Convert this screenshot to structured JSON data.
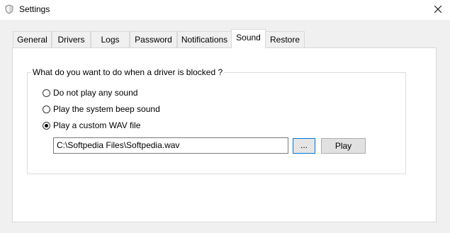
{
  "window": {
    "title": "Settings",
    "app_icon": "shield-icon",
    "close_icon": "close-icon"
  },
  "tabs": [
    {
      "label": "General"
    },
    {
      "label": "Drivers"
    },
    {
      "label": "Logs"
    },
    {
      "label": "Password"
    },
    {
      "label": "Notifications"
    },
    {
      "label": "Sound",
      "active": true
    },
    {
      "label": "Restore"
    }
  ],
  "sound": {
    "group_label": "What do you want to do when a driver is blocked ?",
    "options": [
      {
        "label": "Do not play any sound",
        "checked": false
      },
      {
        "label": "Play the system beep sound",
        "checked": false
      },
      {
        "label": "Play a custom WAV file",
        "checked": true
      }
    ],
    "wav_path": "C:\\Softpedia Files\\Softpedia.wav",
    "browse_label": "...",
    "play_label": "Play"
  }
}
